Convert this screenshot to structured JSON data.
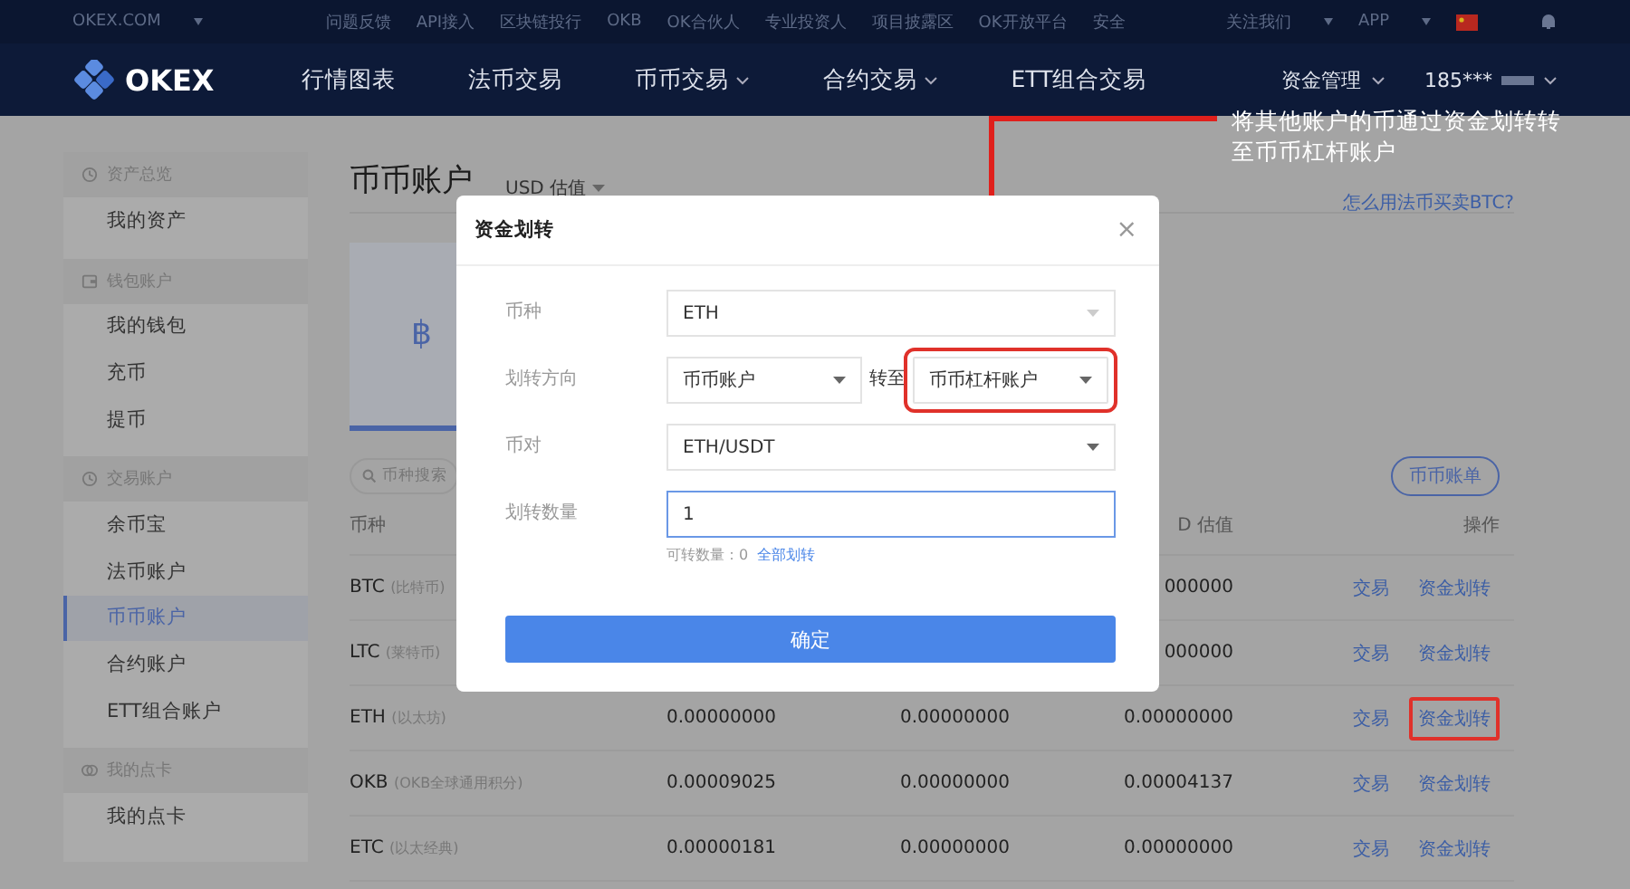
{
  "top_links": {
    "site": "OKEX.COM",
    "links": [
      "问题反馈",
      "API接入",
      "区块链投行",
      "OKB",
      "OK合伙人",
      "专业投资人",
      "项目披露区",
      "OK开放平台",
      "安全"
    ],
    "right": [
      "关注我们",
      "APP"
    ]
  },
  "nav": {
    "logo": "OKEX",
    "items": [
      {
        "label": "行情图表",
        "dropdown": false
      },
      {
        "label": "法币交易",
        "dropdown": false
      },
      {
        "label": "币币交易",
        "dropdown": true
      },
      {
        "label": "合约交易",
        "dropdown": true
      },
      {
        "label": "ETT组合交易",
        "dropdown": false
      }
    ],
    "right": [
      {
        "label": "资金管理",
        "kind": "menu"
      },
      {
        "label": "185***",
        "kind": "account"
      }
    ]
  },
  "sidebar": {
    "groups": [
      {
        "title": "资产总览",
        "items": [
          {
            "label": "我的资产",
            "selected": false
          }
        ]
      },
      {
        "title": "钱包账户",
        "items": [
          {
            "label": "我的钱包",
            "selected": false
          },
          {
            "label": "充币",
            "selected": false
          },
          {
            "label": "提币",
            "selected": false
          }
        ]
      },
      {
        "title": "交易账户",
        "items": [
          {
            "label": "余币宝",
            "selected": false
          },
          {
            "label": "法币账户",
            "selected": false
          },
          {
            "label": "币币账户",
            "selected": true
          },
          {
            "label": "合约账户",
            "selected": false
          },
          {
            "label": "ETT组合账户",
            "selected": false
          }
        ]
      },
      {
        "title": "我的点卡",
        "items": [
          {
            "label": "我的点卡",
            "selected": false
          }
        ]
      }
    ]
  },
  "content": {
    "title": "币币账户",
    "valuation": "USD 估值",
    "help_link": "怎么用法币买卖BTC?",
    "card_symbol": "฿",
    "search": {
      "placeholder": "币种搜索"
    },
    "bill_button": "币币账单"
  },
  "table": {
    "header": {
      "coin": "币种",
      "column_4": "D 估值",
      "actions": "操作"
    },
    "rows": [
      {
        "coin": "BTC",
        "name": "(比特币)",
        "column_4": "000000",
        "actions": [
          {
            "label": "交易",
            "highlighted": false
          },
          {
            "label": "资金划转",
            "highlighted": false
          }
        ]
      },
      {
        "coin": "LTC",
        "name": "(莱特币)",
        "column_4": "000000",
        "actions": [
          {
            "label": "交易",
            "highlighted": false
          },
          {
            "label": "资金划转",
            "highlighted": false
          }
        ]
      },
      {
        "coin": "ETH",
        "name": "(以太坊)",
        "column_2": "0.00000000",
        "column_3": "0.00000000",
        "column_4": "0.00000000",
        "actions": [
          {
            "label": "交易",
            "highlighted": false
          },
          {
            "label": "资金划转",
            "highlighted": true
          }
        ]
      },
      {
        "coin": "OKB",
        "name": "(OKB全球通用积分)",
        "column_2": "0.00009025",
        "column_3": "0.00000000",
        "column_4": "0.00004137",
        "actions": [
          {
            "label": "交易",
            "highlighted": false
          },
          {
            "label": "资金划转",
            "highlighted": false
          }
        ]
      },
      {
        "coin": "ETC",
        "name": "(以太经典)",
        "column_2": "0.00000181",
        "column_3": "0.00000000",
        "column_4": "0.00000000",
        "actions": [
          {
            "label": "交易",
            "highlighted": false
          },
          {
            "label": "资金划转",
            "highlighted": false
          }
        ]
      }
    ]
  },
  "modal": {
    "title": "资金划转",
    "close": "×",
    "fields": [
      {
        "kind": "select",
        "label": "币种",
        "value": "ETH",
        "disabled": true
      },
      {
        "kind": "direction",
        "label": "划转方向",
        "from": "币币账户",
        "connector": "转至",
        "to": "币币杠杆账户",
        "highlighted": true
      },
      {
        "kind": "select",
        "label": "币对",
        "value": "ETH/USDT",
        "disabled": false
      },
      {
        "kind": "input",
        "label": "划转数量",
        "value": "1",
        "focused": true,
        "hint": "可转数量：0",
        "hint_link": "全部划转"
      }
    ],
    "confirm": "确定"
  },
  "annotation": {
    "text": "将其他账户的币通过资金划转转至币币杠杆账户"
  }
}
